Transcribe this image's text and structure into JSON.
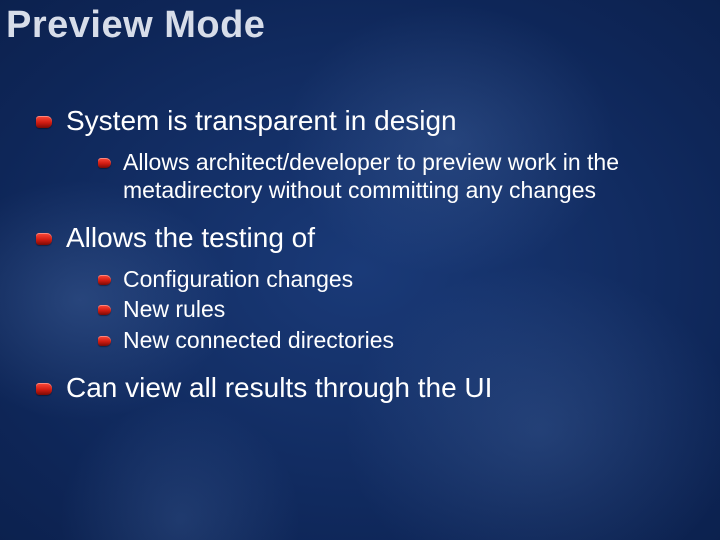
{
  "slide": {
    "title": "Preview Mode",
    "items": [
      {
        "text": "System is transparent in design",
        "children": [
          {
            "text": "Allows architect/developer to preview work in the metadirectory without committing any changes"
          }
        ]
      },
      {
        "text": "Allows the testing of",
        "children": [
          {
            "text": "Configuration changes"
          },
          {
            "text": "New rules"
          },
          {
            "text": "New connected directories"
          }
        ]
      },
      {
        "text": "Can view all results through the UI",
        "children": []
      }
    ]
  }
}
